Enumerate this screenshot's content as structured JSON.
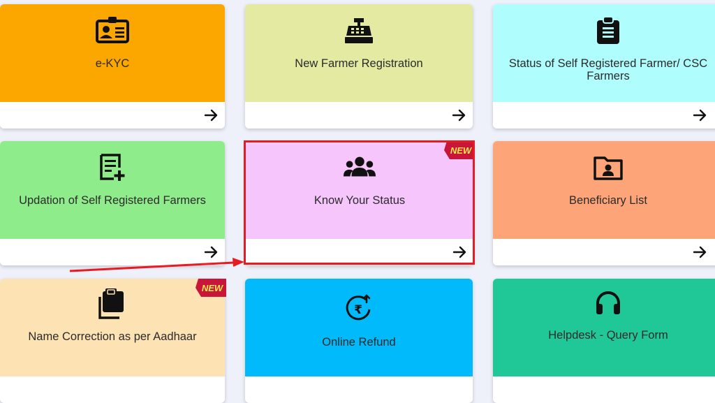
{
  "tiles": [
    {
      "label": "e-KYC",
      "icon": "id-card-icon",
      "color": "#fca600"
    },
    {
      "label": "New Farmer Registration",
      "icon": "cash-register-icon",
      "color": "#e5eaa2"
    },
    {
      "label": "Status of Self Registered Farmer/ CSC Farmers",
      "icon": "clipboard-list-icon",
      "color": "#b0fdfe"
    },
    {
      "label": "Updation of Self Registered Farmers",
      "icon": "document-add-icon",
      "color": "#8fec8b"
    },
    {
      "label": "Know Your Status",
      "icon": "users-group-icon",
      "color": "#f6c5fb",
      "badge": "NEW"
    },
    {
      "label": "Beneficiary List",
      "icon": "folder-user-icon",
      "color": "#fda479"
    },
    {
      "label": "Name Correction as per Aadhaar",
      "icon": "clipboard-copy-icon",
      "color": "#fde2b3",
      "badge": "NEW"
    },
    {
      "label": "Online Refund",
      "icon": "rupee-refund-icon",
      "color": "#00bafb"
    },
    {
      "label": "Helpdesk - Query Form",
      "icon": "headphones-icon",
      "color": "#21c897"
    }
  ],
  "colors": {
    "badge": "#c9153a",
    "highlight": "#e81b23",
    "background": "#eef0fa"
  }
}
